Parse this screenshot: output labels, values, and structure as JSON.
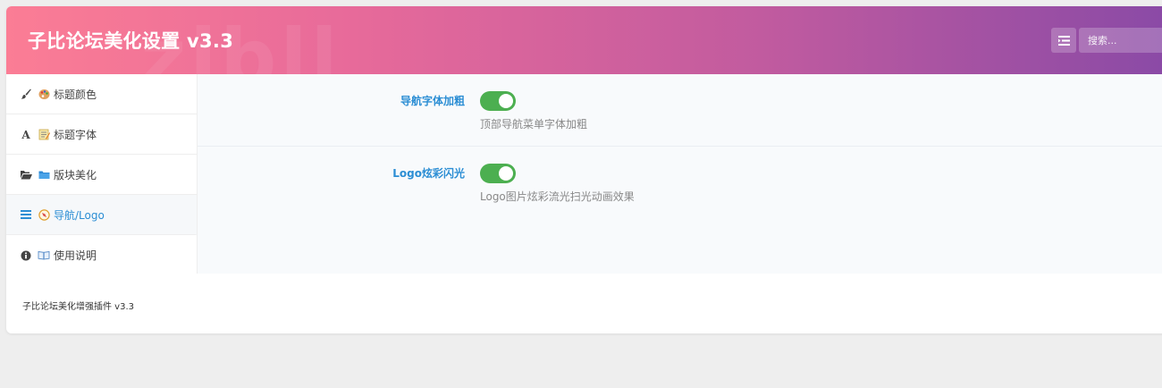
{
  "header": {
    "title": "子比论坛美化设置 v3.3",
    "watermark": "zibll",
    "search_placeholder": "搜索..."
  },
  "sidebar": {
    "items": [
      {
        "label": "标题颜色",
        "icon": "paintbrush-icon",
        "emoji": "🎨",
        "active": false
      },
      {
        "label": "标题字体",
        "icon": "font-icon",
        "emoji": "📝",
        "active": false
      },
      {
        "label": "版块美化",
        "icon": "folder-open-icon",
        "emoji": "📁",
        "active": false
      },
      {
        "label": "导航/Logo",
        "icon": "bars-icon",
        "emoji": "🧭",
        "active": true
      },
      {
        "label": "使用说明",
        "icon": "info-circle-icon",
        "emoji": "📖",
        "active": false
      }
    ]
  },
  "settings": [
    {
      "label": "导航字体加粗",
      "desc": "顶部导航菜单字体加粗",
      "enabled": true
    },
    {
      "label": "Logo炫彩闪光",
      "desc": "Logo图片炫彩流光扫光动画效果",
      "enabled": true
    }
  ],
  "footer": {
    "text": "子比论坛美化增强插件 v3.3"
  },
  "colors": {
    "accent": "#2c8ed4",
    "toggle_on": "#4caf50",
    "header_gradient_start": "#fb7d95",
    "header_gradient_end": "#8a4aa6"
  }
}
